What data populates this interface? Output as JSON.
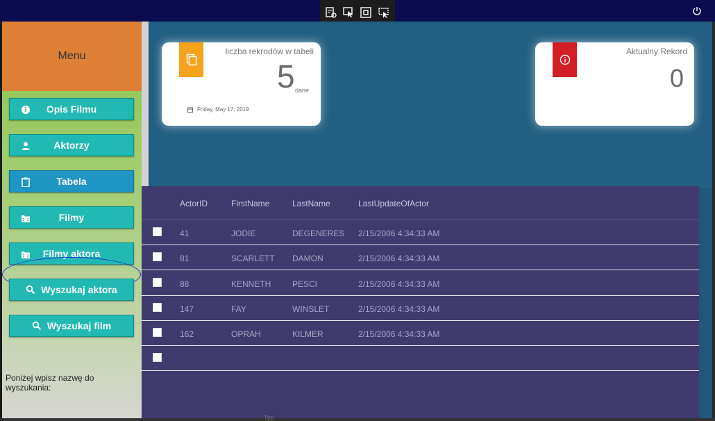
{
  "topbar": {
    "devtools": [
      "live-visual-tree-icon",
      "select-element-icon",
      "display-adorners-icon",
      "track-focus-icon"
    ],
    "power_icon": "power-icon"
  },
  "sidebar": {
    "menu_title": "Menu",
    "items": [
      {
        "label": "Opis Filmu",
        "icon": "info-icon"
      },
      {
        "label": "Aktorzy",
        "icon": "person-icon"
      },
      {
        "label": "Tabela",
        "icon": "clipboard-icon"
      },
      {
        "label": "Filmy",
        "icon": "film-folder-icon"
      },
      {
        "label": "Filmy aktora",
        "icon": "film-folder-icon"
      },
      {
        "label": "Wyszukaj aktora",
        "icon": "search-icon"
      },
      {
        "label": "Wyszukaj film",
        "icon": "search-icon"
      }
    ],
    "search_hint": "Poniżej wpisz nazwę do wyszukania:"
  },
  "cards": {
    "count": {
      "label": "liczba rekrodów w tabeli",
      "value": "5",
      "unit": "dane",
      "date": "Friday, May 17, 2019",
      "color": "#f7a21b"
    },
    "record": {
      "label": "Aktualny Rekord",
      "value": "0",
      "color": "#d21f26"
    }
  },
  "grid": {
    "columns": [
      "ActorID",
      "FirstName",
      "LastName",
      "LastUpdateOfActor"
    ],
    "rows": [
      [
        "41",
        "JODIE",
        "DEGENERES",
        "2/15/2006 4:34:33 AM"
      ],
      [
        "81",
        "SCARLETT",
        "DAMON",
        "2/15/2006 4:34:33 AM"
      ],
      [
        "88",
        "KENNETH",
        "PESCI",
        "2/15/2006 4:34:33 AM"
      ],
      [
        "147",
        "FAY",
        "WINSLET",
        "2/15/2006 4:34:33 AM"
      ],
      [
        "162",
        "OPRAH",
        "KILMER",
        "2/15/2006 4:34:33 AM"
      ],
      [
        "",
        "",
        "",
        ""
      ]
    ]
  },
  "footer_partial": "Typ"
}
